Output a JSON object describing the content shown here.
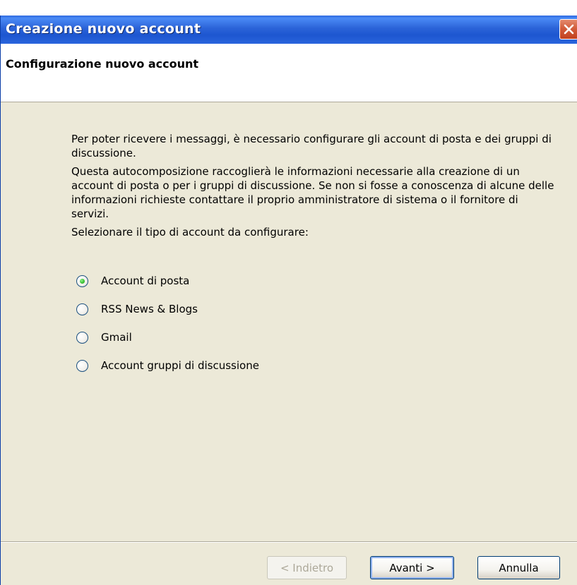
{
  "window": {
    "title": "Creazione nuovo account"
  },
  "header": {
    "title": "Configurazione nuovo account"
  },
  "content": {
    "intro": "Per poter ricevere i messaggi, è necessario configurare gli account di posta e dei gruppi di discussione.",
    "description": "Questa autocomposizione raccoglierà le informazioni necessarie alla creazione di un account di posta o per i gruppi di discussione. Se non si fosse a conoscenza di alcune delle informazioni richieste contattare il proprio amministratore di sistema o il fornitore di servizi.",
    "prompt": "Selezionare il tipo di account da configurare:"
  },
  "account_types": [
    {
      "label": "Account di posta",
      "selected": true
    },
    {
      "label": "RSS News & Blogs",
      "selected": false
    },
    {
      "label": "Gmail",
      "selected": false
    },
    {
      "label": "Account gruppi di discussione",
      "selected": false
    }
  ],
  "buttons": {
    "back": "< Indietro",
    "next": "Avanti >",
    "cancel": "Annulla"
  },
  "colors": {
    "titlebar": "#2b63d8",
    "dialog_background": "#ece9d8",
    "radio_selected": "#3ec237",
    "close_button": "#c2421f"
  }
}
